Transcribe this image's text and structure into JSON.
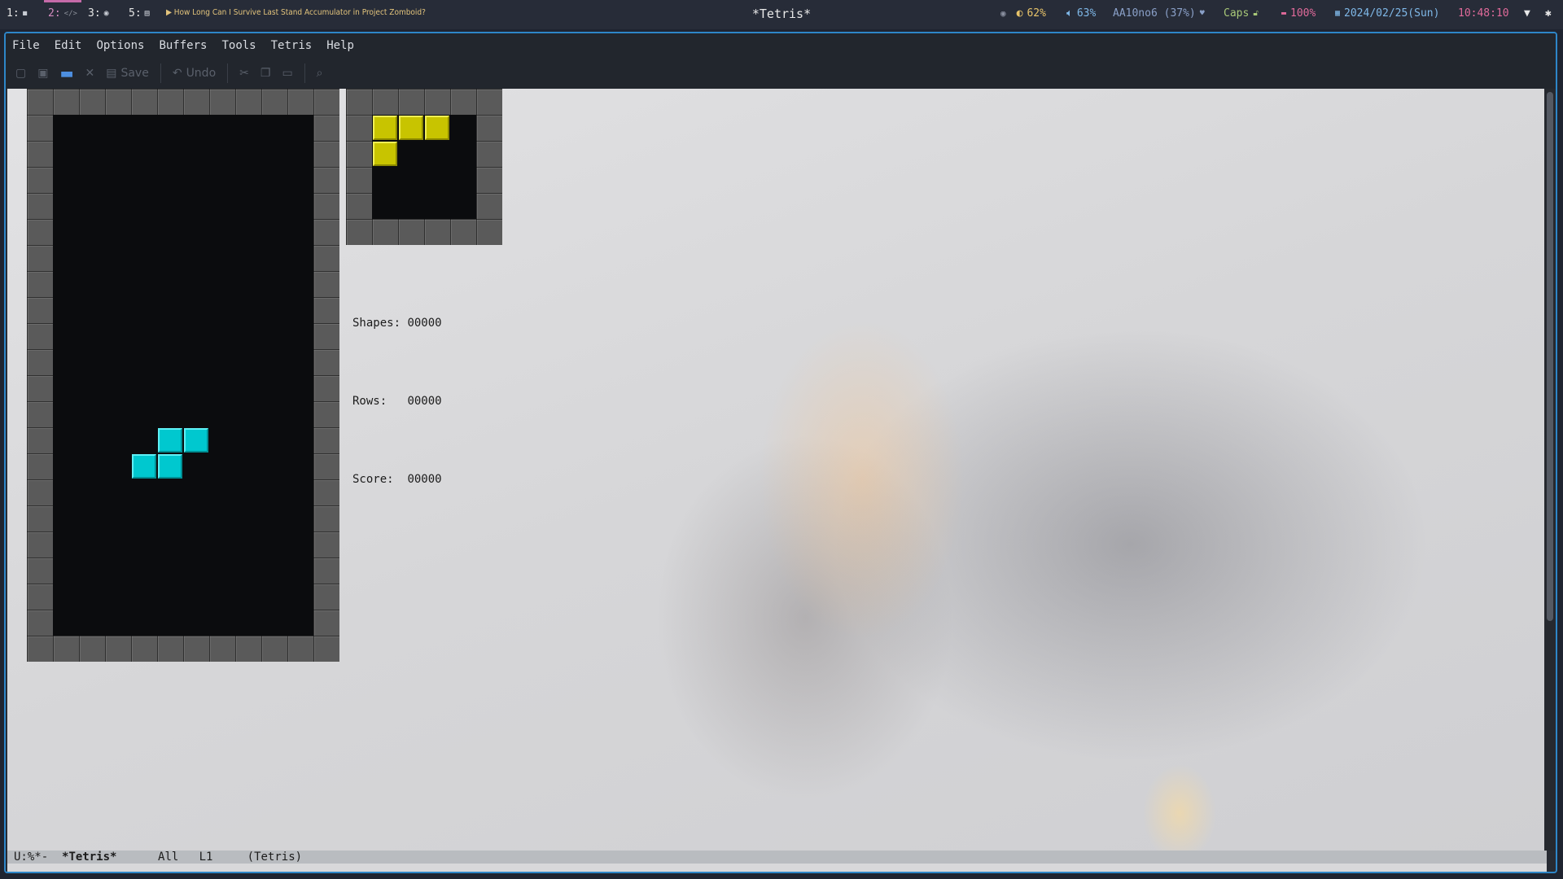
{
  "topbar": {
    "workspaces": [
      {
        "num": "1:",
        "icon": "terminal-icon",
        "glyph": "◼"
      },
      {
        "num": "2:",
        "icon": "code-icon",
        "glyph": "</>"
      },
      {
        "num": "3:",
        "icon": "record-icon",
        "glyph": "◉"
      },
      {
        "num": "5:",
        "icon": "file-icon",
        "glyph": "▤"
      }
    ],
    "media_title": "▶ How Long Can I Survive Last Stand Accumulator in Project Zomboid?",
    "window_title": "*Tetris*",
    "brightness": "62%",
    "volume": "63%",
    "keyboard": "AA10no6 (37%)",
    "caps": "Caps",
    "battery": "100%",
    "date": "2024/02/25(Sun)",
    "time": "10:48:10"
  },
  "menubar": {
    "items": [
      "File",
      "Edit",
      "Options",
      "Buffers",
      "Tools",
      "Tetris",
      "Help"
    ]
  },
  "toolbar": {
    "save_label": "Save",
    "undo_label": "Undo"
  },
  "tetris": {
    "shapes_label": "Shapes:",
    "shapes_value": "00000",
    "rows_label": "Rows:",
    "rows_value": "00000",
    "score_label": "Score:",
    "score_value": "00000",
    "current_piece_color": "#00c8cf",
    "next_piece_color": "#c8c400"
  },
  "modeline": {
    "state": "U:%*-",
    "buffer": "*Tetris*",
    "position": "All",
    "line": "L1",
    "mode": "(Tetris)"
  },
  "colors": {
    "frame_border": "#2e86c8",
    "workspace_active": "#c56aa8",
    "media_text": "#e3c47c",
    "brightness": "#e8c46a",
    "volume": "#7fb8e8",
    "keyboard": "#8aa0c8",
    "caps": "#a8c878",
    "battery": "#e06a9a",
    "date": "#7fb8e8",
    "time": "#e06a9a"
  }
}
